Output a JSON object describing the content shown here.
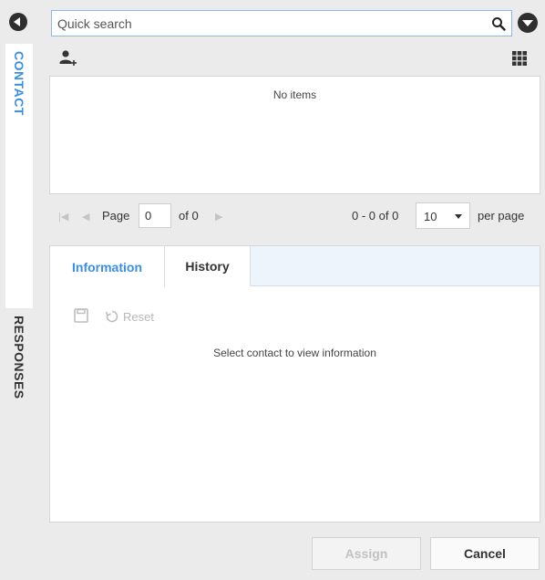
{
  "rail": {
    "tabs": [
      {
        "label": "CONTACT",
        "active": true
      },
      {
        "label": "RESPONSES",
        "active": false
      }
    ]
  },
  "search": {
    "placeholder": "Quick search",
    "value": ""
  },
  "list": {
    "empty_message": "No items"
  },
  "pager": {
    "page_label": "Page",
    "page_value": "0",
    "of_label": "of 0",
    "range_label": "0 - 0 of 0",
    "page_size": "10",
    "per_page_label": "per page"
  },
  "details": {
    "tabs": [
      {
        "label": "Information",
        "active": true
      },
      {
        "label": "History",
        "active": false
      }
    ],
    "reset_label": "Reset",
    "empty_message": "Select contact to view information"
  },
  "footer": {
    "assign_label": "Assign",
    "cancel_label": "Cancel"
  },
  "colors": {
    "accent": "#3b8ee6",
    "dark_icon": "#2f2f2f",
    "background": "#ebebeb"
  }
}
